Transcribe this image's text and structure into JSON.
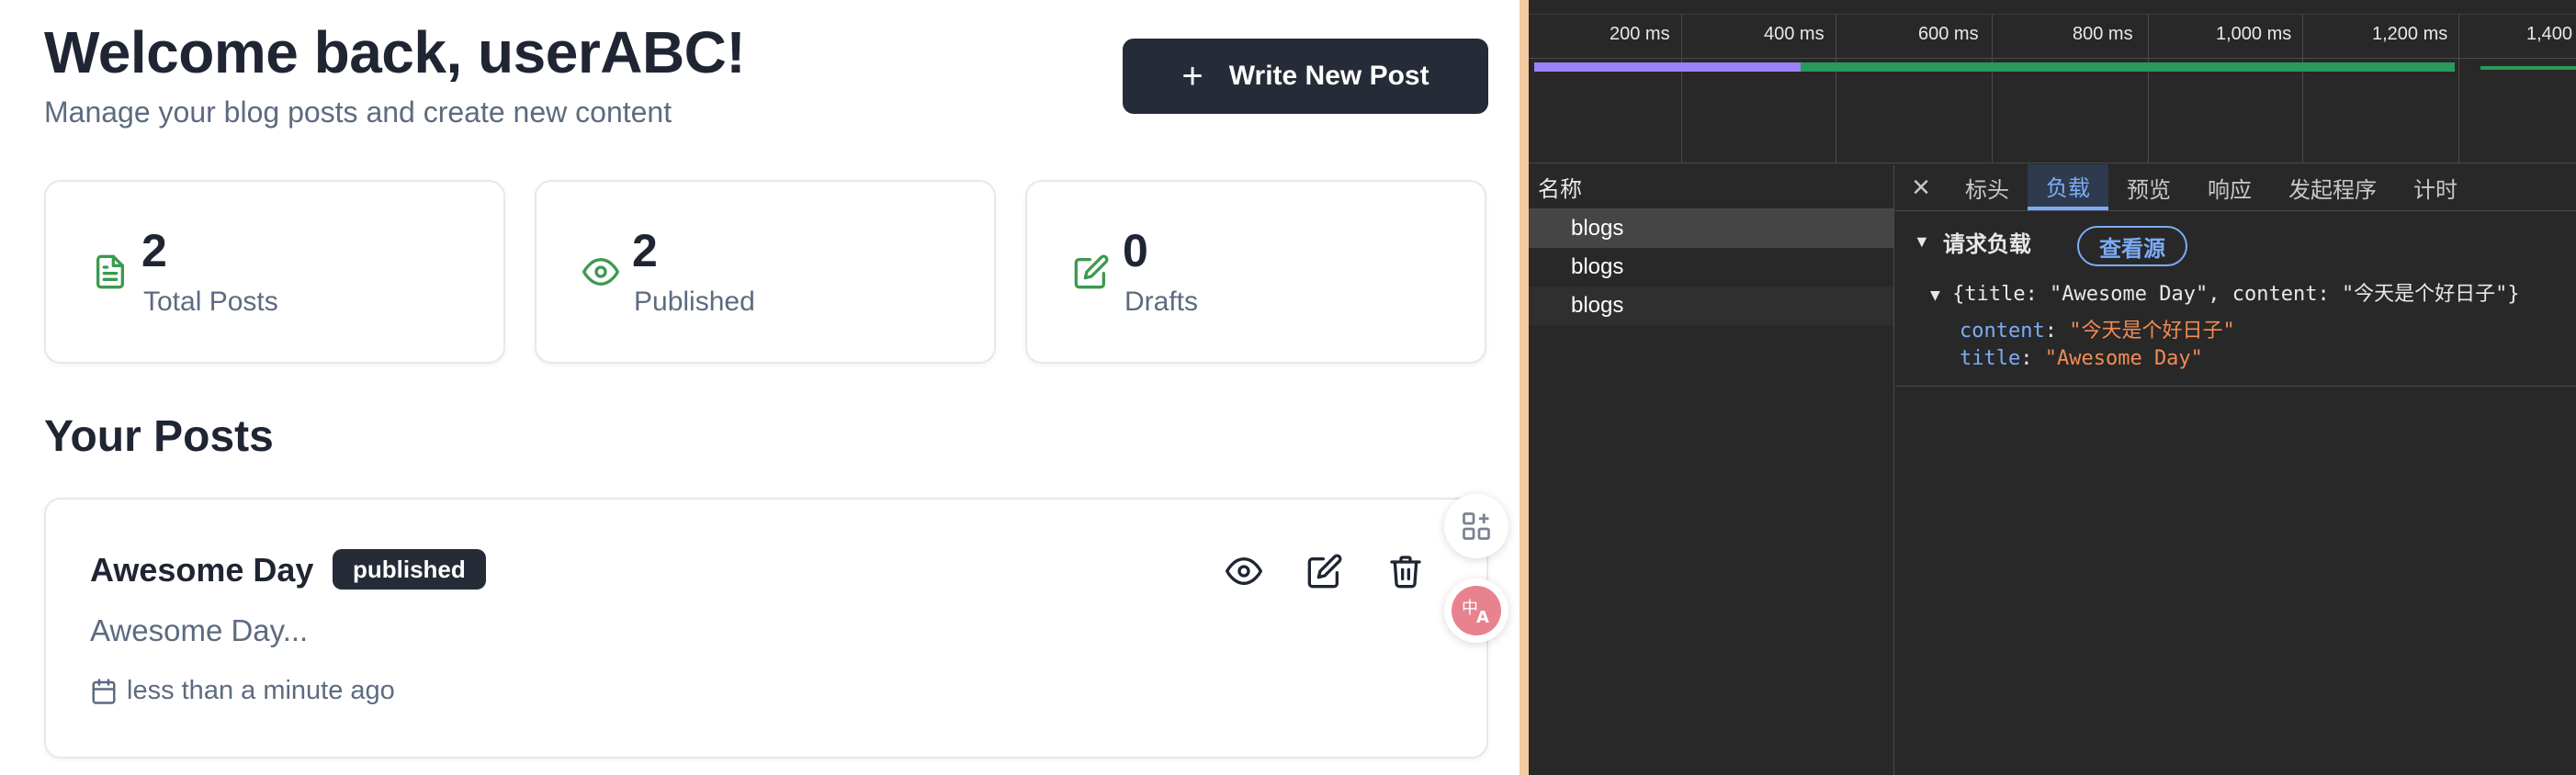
{
  "app": {
    "welcome": "Welcome back, userABC!",
    "subtitle": "Manage your blog posts and create new content",
    "write_button": "Write New Post",
    "stats": [
      {
        "value": "2",
        "label": "Total Posts",
        "icon": "file-text-icon"
      },
      {
        "value": "2",
        "label": "Published",
        "icon": "eye-icon"
      },
      {
        "value": "0",
        "label": "Drafts",
        "icon": "edit-icon"
      }
    ],
    "section_title": "Your Posts",
    "posts": [
      {
        "title": "Awesome Day",
        "status": "published",
        "excerpt": "Awesome Day...",
        "date": "less than a minute ago"
      }
    ],
    "accent_color": "#3b9a4f",
    "dark_color": "#252b37"
  },
  "devtools": {
    "timeline_ticks": [
      "200 ms",
      "400 ms",
      "600 ms",
      "800 ms",
      "1,000 ms",
      "1,200 ms",
      "1,400"
    ],
    "name_header": "名称",
    "requests": [
      "blogs",
      "blogs",
      "blogs"
    ],
    "tabs": [
      "标头",
      "负载",
      "预览",
      "响应",
      "发起程序",
      "计时"
    ],
    "active_tab": "负载",
    "payload_title": "请求负载",
    "view_source": "查看源",
    "payload_summary": "{title: \"Awesome Day\", content: \"今天是个好日子\"}",
    "payload_content_key": "content",
    "payload_content_value": "\"今天是个好日子\"",
    "payload_title_key": "title",
    "payload_title_value": "\"Awesome Day\""
  }
}
